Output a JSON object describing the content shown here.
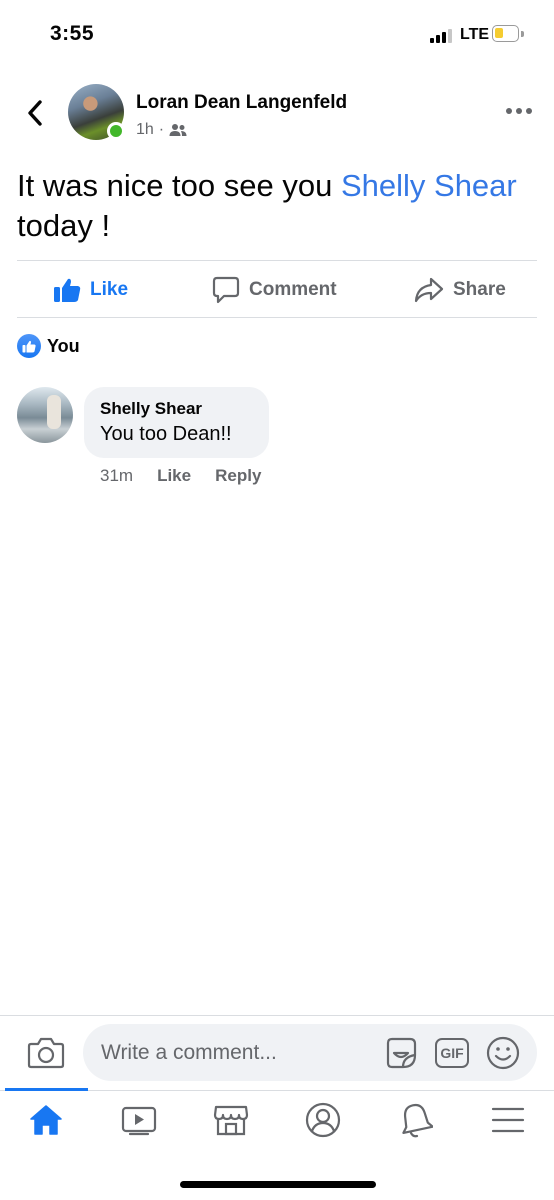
{
  "status_bar": {
    "time": "3:55",
    "network": "LTE",
    "battery_level": 0.4,
    "battery_color": "#f5cc30"
  },
  "post": {
    "author": "Loran Dean Langenfeld",
    "time_ago": "1h",
    "separator": "·",
    "audience_icon": "friends-icon",
    "online": true,
    "text_before": "It was nice too see you ",
    "mention": "Shelly Shear",
    "text_after": "today !"
  },
  "actions": {
    "like": "Like",
    "comment": "Comment",
    "share": "Share"
  },
  "reactions": {
    "label": "You",
    "icon": "like-badge-icon"
  },
  "comments": [
    {
      "author": "Shelly Shear",
      "text": "You too Dean!!",
      "time_ago": "31m",
      "like": "Like",
      "reply": "Reply"
    }
  ],
  "composer": {
    "placeholder": "Write a comment...",
    "gif_label": "GIF"
  },
  "tabs": [
    {
      "name": "home",
      "icon": "home-icon",
      "active": true
    },
    {
      "name": "watch",
      "icon": "video-icon",
      "active": false
    },
    {
      "name": "marketplace",
      "icon": "marketplace-icon",
      "active": false
    },
    {
      "name": "profile",
      "icon": "profile-icon",
      "active": false
    },
    {
      "name": "notifications",
      "icon": "bell-icon",
      "active": false
    },
    {
      "name": "menu",
      "icon": "menu-icon",
      "active": false
    }
  ],
  "colors": {
    "accent": "#1877f2",
    "mention": "#3578e5",
    "secondary_text": "#65676b",
    "online": "#42b72a"
  }
}
